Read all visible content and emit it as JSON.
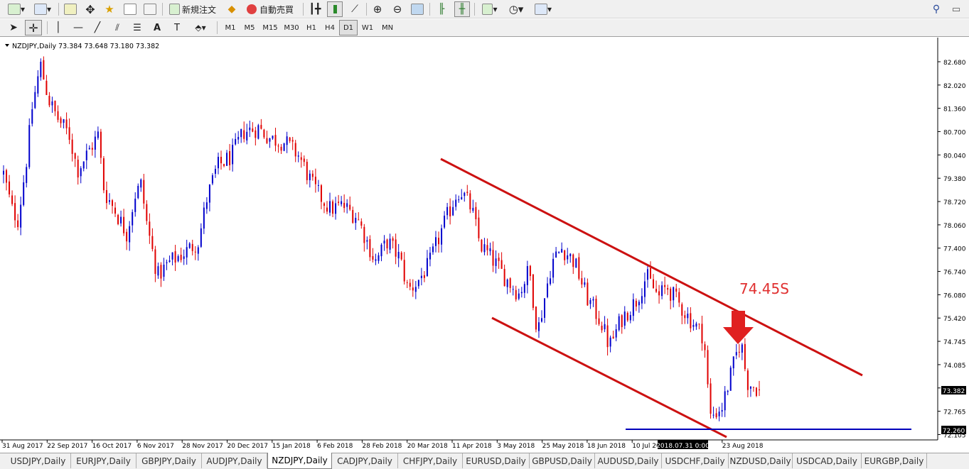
{
  "toolbar": {
    "new_order": "新規注文",
    "auto_trade": "自動売買",
    "timeframes": [
      "M1",
      "M5",
      "M15",
      "M30",
      "H1",
      "H4",
      "D1",
      "W1",
      "MN"
    ],
    "active_timeframe": "D1"
  },
  "chart": {
    "header": "NZDJPY,Daily  73.384 73.648 73.180 73.382",
    "annotation": "74.45S",
    "price_labels": [
      "82.680",
      "82.020",
      "81.360",
      "80.700",
      "80.040",
      "79.380",
      "78.720",
      "78.060",
      "77.400",
      "76.740",
      "76.080",
      "75.420",
      "74.745",
      "74.085",
      "73.425",
      "72.765",
      "72.105"
    ],
    "current_price": "73.382",
    "support_price": "72.260",
    "date_labels": [
      "31 Aug 2017",
      "22 Sep 2017",
      "16 Oct 2017",
      "6 Nov 2017",
      "28 Nov 2017",
      "20 Dec 2017",
      "15 Jan 2018",
      "6 Feb 2018",
      "28 Feb 2018",
      "20 Mar 2018",
      "11 Apr 2018",
      "3 May 2018",
      "25 May 2018",
      "18 Jun 2018",
      "10 Jul 2018",
      "",
      "23 Aug 2018"
    ],
    "crosshair_date": "2018.07.31 0:00",
    "colors": {
      "bull": "#0000cc",
      "bear": "#e00000",
      "channel": "#cc1111",
      "support": "#0000bb",
      "arrow": "#e02020"
    }
  },
  "chart_data": {
    "type": "candlestick",
    "symbol": "NZDJPY",
    "timeframe": "Daily",
    "ylim": [
      72.105,
      82.68
    ],
    "close_path": [
      {
        "date": "2017-08-31",
        "close": 79.5
      },
      {
        "date": "2017-09-04",
        "close": 78.5
      },
      {
        "date": "2017-09-07",
        "close": 78.2
      },
      {
        "date": "2017-09-11",
        "close": 79.8
      },
      {
        "date": "2017-09-14",
        "close": 81.4
      },
      {
        "date": "2017-09-18",
        "close": 82.6
      },
      {
        "date": "2017-09-22",
        "close": 81.6
      },
      {
        "date": "2017-09-26",
        "close": 81.1
      },
      {
        "date": "2017-10-02",
        "close": 80.6
      },
      {
        "date": "2017-10-06",
        "close": 79.6
      },
      {
        "date": "2017-10-11",
        "close": 80.1
      },
      {
        "date": "2017-10-16",
        "close": 80.6
      },
      {
        "date": "2017-10-19",
        "close": 79.0
      },
      {
        "date": "2017-10-24",
        "close": 78.5
      },
      {
        "date": "2017-10-30",
        "close": 77.8
      },
      {
        "date": "2017-11-03",
        "close": 78.9
      },
      {
        "date": "2017-11-06",
        "close": 79.2
      },
      {
        "date": "2017-11-09",
        "close": 78.0
      },
      {
        "date": "2017-11-14",
        "close": 76.6
      },
      {
        "date": "2017-11-20",
        "close": 77.0
      },
      {
        "date": "2017-11-28",
        "close": 77.3
      },
      {
        "date": "2017-12-04",
        "close": 77.6
      },
      {
        "date": "2017-12-08",
        "close": 78.8
      },
      {
        "date": "2017-12-13",
        "close": 79.7
      },
      {
        "date": "2017-12-20",
        "close": 80.0
      },
      {
        "date": "2017-12-26",
        "close": 80.7
      },
      {
        "date": "2018-01-02",
        "close": 80.8
      },
      {
        "date": "2018-01-08",
        "close": 80.5
      },
      {
        "date": "2018-01-15",
        "close": 80.4
      },
      {
        "date": "2018-01-22",
        "close": 80.0
      },
      {
        "date": "2018-01-29",
        "close": 79.1
      },
      {
        "date": "2018-02-06",
        "close": 78.5
      },
      {
        "date": "2018-02-12",
        "close": 78.6
      },
      {
        "date": "2018-02-19",
        "close": 78.3
      },
      {
        "date": "2018-02-28",
        "close": 77.0
      },
      {
        "date": "2018-03-06",
        "close": 77.6
      },
      {
        "date": "2018-03-12",
        "close": 77.1
      },
      {
        "date": "2018-03-16",
        "close": 76.2
      },
      {
        "date": "2018-03-20",
        "close": 76.4
      },
      {
        "date": "2018-03-26",
        "close": 76.9
      },
      {
        "date": "2018-04-02",
        "close": 78.0
      },
      {
        "date": "2018-04-09",
        "close": 79.0
      },
      {
        "date": "2018-04-11",
        "close": 79.0
      },
      {
        "date": "2018-04-16",
        "close": 78.5
      },
      {
        "date": "2018-04-20",
        "close": 77.5
      },
      {
        "date": "2018-04-27",
        "close": 77.0
      },
      {
        "date": "2018-05-03",
        "close": 76.5
      },
      {
        "date": "2018-05-09",
        "close": 76.1
      },
      {
        "date": "2018-05-14",
        "close": 76.8
      },
      {
        "date": "2018-05-18",
        "close": 75.0
      },
      {
        "date": "2018-05-25",
        "close": 77.0
      },
      {
        "date": "2018-05-30",
        "close": 77.4
      },
      {
        "date": "2018-06-05",
        "close": 77.0
      },
      {
        "date": "2018-06-11",
        "close": 76.0
      },
      {
        "date": "2018-06-18",
        "close": 75.3
      },
      {
        "date": "2018-06-22",
        "close": 74.6
      },
      {
        "date": "2018-06-28",
        "close": 75.4
      },
      {
        "date": "2018-07-05",
        "close": 75.9
      },
      {
        "date": "2018-07-10",
        "close": 76.6
      },
      {
        "date": "2018-07-16",
        "close": 76.0
      },
      {
        "date": "2018-07-20",
        "close": 76.3
      },
      {
        "date": "2018-07-26",
        "close": 75.8
      },
      {
        "date": "2018-07-31",
        "close": 75.4
      },
      {
        "date": "2018-08-07",
        "close": 74.9
      },
      {
        "date": "2018-08-10",
        "close": 72.6
      },
      {
        "date": "2018-08-16",
        "close": 72.9
      },
      {
        "date": "2018-08-22",
        "close": 74.2
      },
      {
        "date": "2018-08-25",
        "close": 74.8
      },
      {
        "date": "2018-08-28",
        "close": 73.6
      },
      {
        "date": "2018-09-03",
        "close": 73.38
      }
    ],
    "annotation": "74.45S",
    "current_price": 73.382,
    "support_level": 72.26
  },
  "tabs": [
    "USDJPY,Daily",
    "EURJPY,Daily",
    "GBPJPY,Daily",
    "AUDJPY,Daily",
    "NZDJPY,Daily",
    "CADJPY,Daily",
    "CHFJPY,Daily",
    "EURUSD,Daily",
    "GBPUSD,Daily",
    "AUDUSD,Daily",
    "USDCHF,Daily",
    "NZDUSD,Daily",
    "USDCAD,Daily",
    "EURGBP,Daily"
  ],
  "active_tab": "NZDJPY,Daily"
}
